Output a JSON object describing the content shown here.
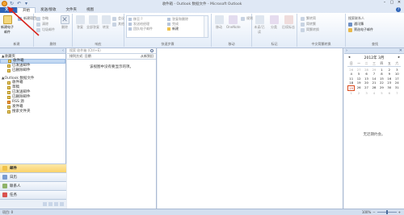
{
  "window": {
    "title": "收件箱 - Outlook 数据文件 - Microsoft Outlook",
    "controls": [
      "–",
      "▢",
      "✕"
    ]
  },
  "tabs": [
    "文件",
    "开始",
    "发送/接收",
    "文件夹",
    "视图"
  ],
  "ribbon": {
    "groups": {
      "new": {
        "label": "新建",
        "new_email": "新建电子邮件",
        "new_items": "新建项目"
      },
      "delete": {
        "label": "删除",
        "ignore": "忽略",
        "cleanup": "清除",
        "junk": "垃圾邮件",
        "delete_btn": "删除"
      },
      "respond": {
        "label": "响应",
        "reply": "答复",
        "reply_all": "全部答复",
        "forward": "转发",
        "meeting": "会议",
        "more": "其他"
      },
      "quicksteps": {
        "label": "快速步骤",
        "items": [
          "移至:?",
          "发送给经理",
          "团队电子邮件",
          "答复和删除",
          "完成",
          "新建"
        ]
      },
      "move": {
        "label": "移动",
        "move_btn": "移动",
        "onenote": "OneNote",
        "rules": "规则"
      },
      "tags": {
        "label": "标记",
        "unread": "未读/已读",
        "categorize": "分类",
        "followup": "后续标志"
      },
      "chinese": {
        "label": "中文简繁转换",
        "to_simplified": "繁转简",
        "to_traditional": "简转繁",
        "convert": "简繁转换"
      },
      "find": {
        "label": "查找",
        "search_people": "搜索联系人",
        "address_book": "通讯簿",
        "filter_email": "筛选电子邮件"
      }
    }
  },
  "nav": {
    "favorites_header": "▲收藏夹",
    "favorites": [
      "收件箱",
      "已发送邮件",
      "已删除邮件"
    ],
    "data_file_header": "▲Outlook 数据文件",
    "folders": [
      "收件箱",
      "草稿",
      "已发送邮件",
      "已删除邮件",
      "RSS 源",
      "发件箱",
      "搜索文件夹"
    ],
    "buttons": [
      "邮件",
      "日历",
      "联系人",
      "任务"
    ]
  },
  "list": {
    "search_placeholder": "搜索 收件箱 (Ctrl+E)",
    "sort_label": "排列方式: 日期",
    "order_label": "从新到旧",
    "empty_text": "该视图中没有要显示的项。"
  },
  "todo": {
    "month": "2012年 3月",
    "weekdays": [
      "日",
      "一",
      "二",
      "三",
      "四",
      "五",
      "六"
    ],
    "days": [
      [
        "26",
        "27",
        "28",
        "29",
        "1",
        "2",
        "3"
      ],
      [
        "4",
        "5",
        "6",
        "7",
        "8",
        "9",
        "10"
      ],
      [
        "11",
        "12",
        "13",
        "14",
        "15",
        "16",
        "17"
      ],
      [
        "18",
        "19",
        "20",
        "21",
        "22",
        "23",
        "24"
      ],
      [
        "25",
        "26",
        "27",
        "28",
        "29",
        "30",
        "31"
      ],
      [
        "1",
        "2",
        "3",
        "4",
        "5",
        "6",
        "7"
      ]
    ],
    "today": "25",
    "no_appointments": "无近期约会。"
  },
  "status": {
    "left": "项目: 0",
    "zoom": "100%"
  }
}
